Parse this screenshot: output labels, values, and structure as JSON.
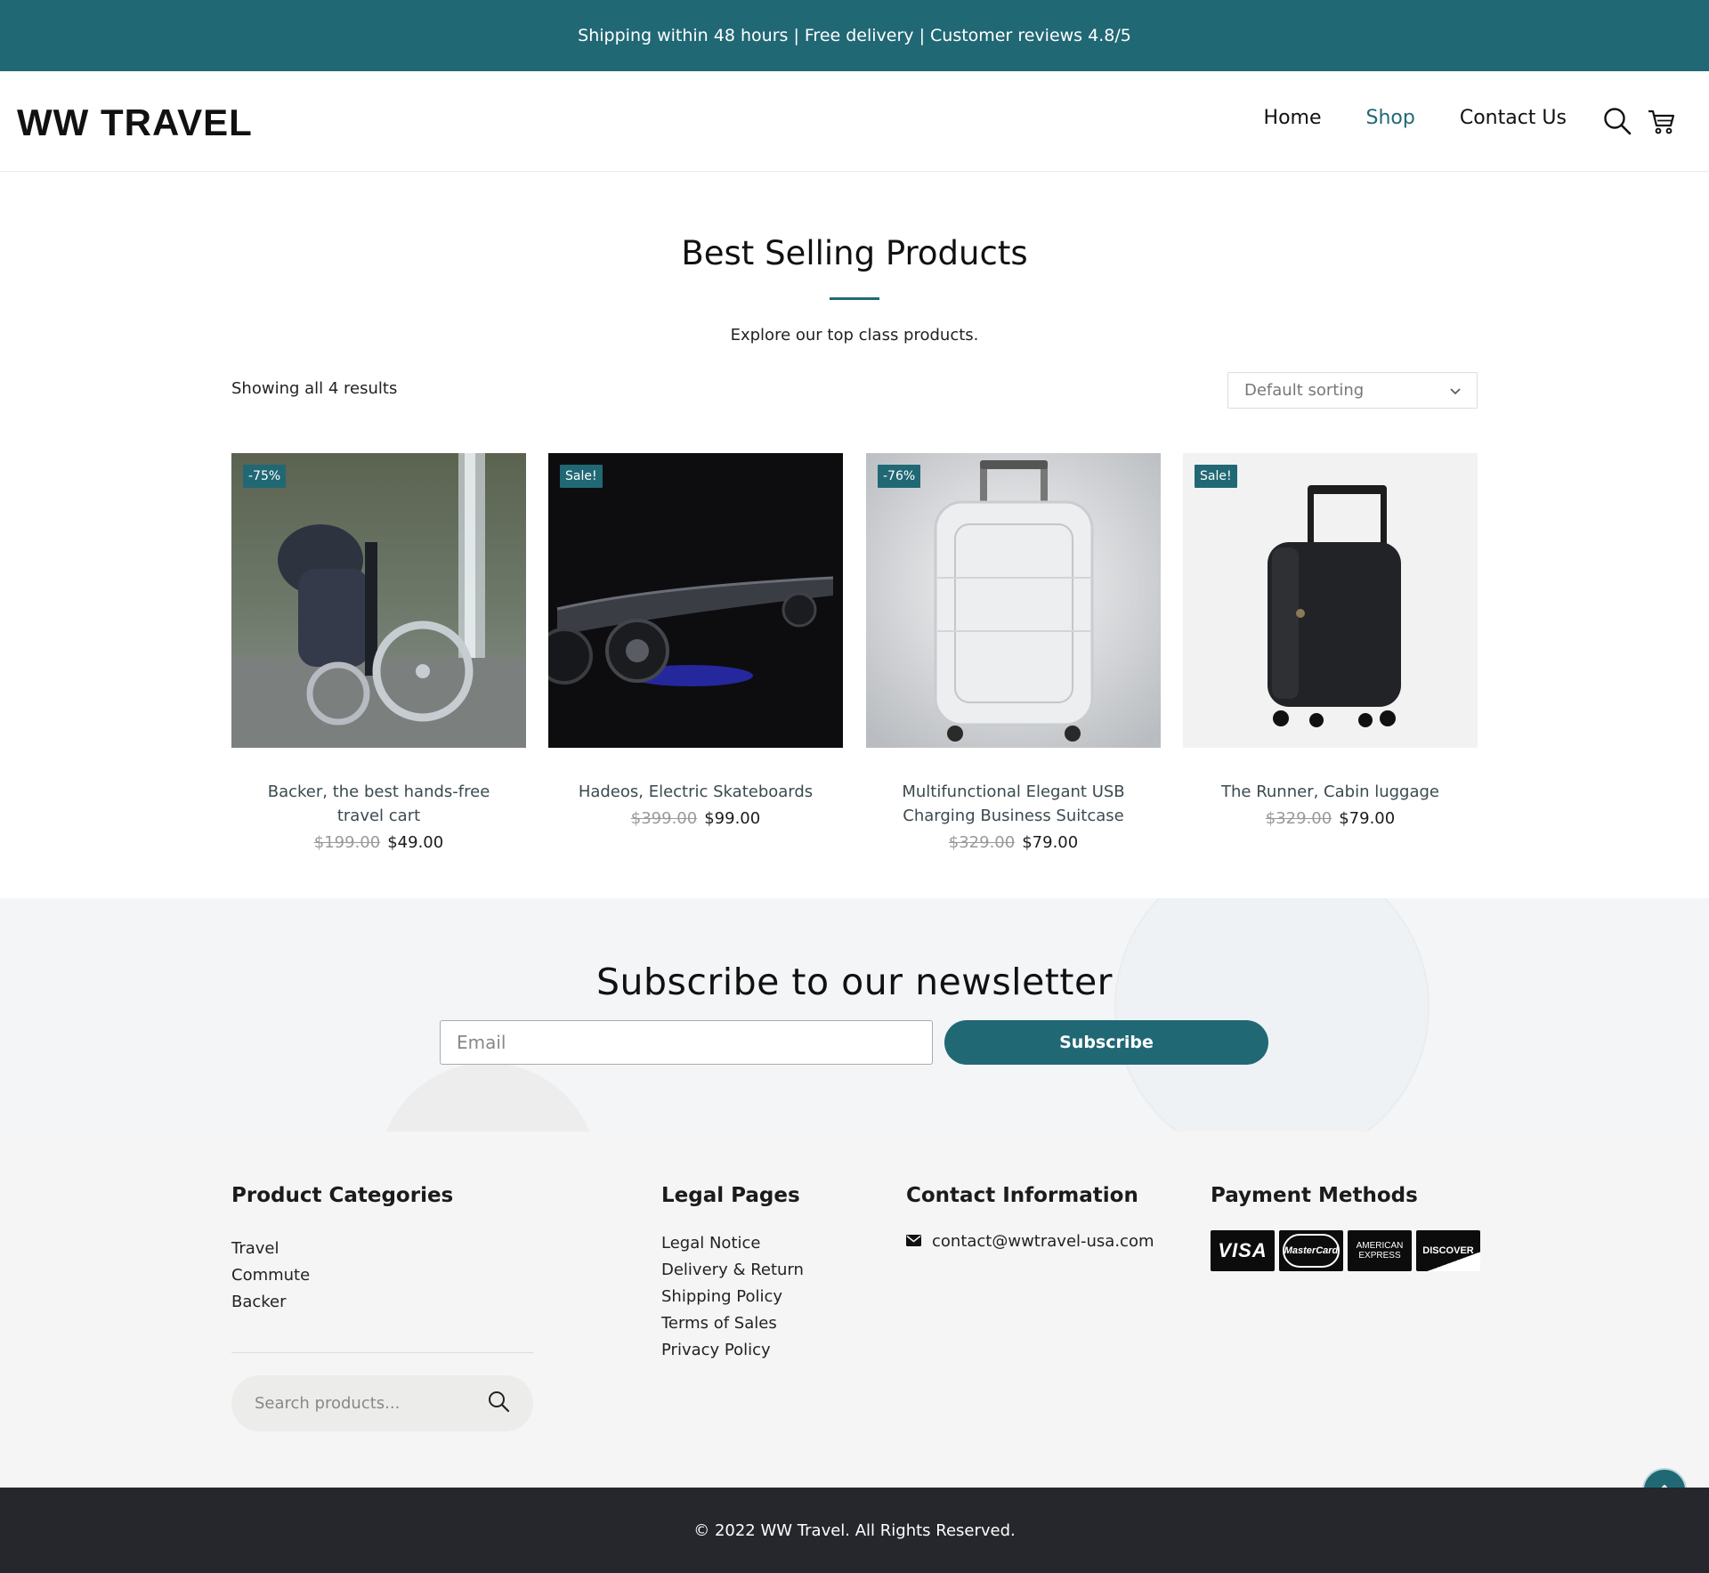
{
  "topbar": {
    "text": "Shipping within 48 hours | Free delivery | Customer reviews 4.8/5",
    "color": "#216875"
  },
  "header": {
    "logo": "WW TRAVEL",
    "nav": [
      "Home",
      "Shop",
      "Contact Us"
    ],
    "active_nav": "Shop",
    "icons": [
      "search-icon",
      "cart-icon"
    ]
  },
  "hero": {
    "title": "Best Selling Products",
    "subtitle": "Explore our top class products."
  },
  "shop": {
    "results_text": "Showing all 4 results",
    "sort_selected": "Default sorting"
  },
  "products": [
    {
      "name": "Backer, the best hands-free travel cart",
      "badge": "-75%",
      "old_price": "$199.00",
      "price": "$49.00"
    },
    {
      "name": "Hadeos, Electric Skateboards",
      "badge": "Sale!",
      "old_price": "$399.00",
      "price": "$99.00"
    },
    {
      "name": "Multifunctional Elegant USB Charging Business Suitcase",
      "badge": "-76%",
      "old_price": "$329.00",
      "price": "$79.00"
    },
    {
      "name": "The Runner, Cabin luggage",
      "badge": "Sale!",
      "old_price": "$329.00",
      "price": "$79.00"
    }
  ],
  "newsletter": {
    "title": "Subscribe to our newsletter",
    "email_placeholder": "Email",
    "button": "Subscribe"
  },
  "footer": {
    "categories": {
      "title": "Product Categories",
      "items": [
        "Travel",
        "Commute",
        "Backer"
      ],
      "search_placeholder": "Search products..."
    },
    "legal": {
      "title": "Legal Pages",
      "items": [
        "Legal Notice",
        "Delivery & Return",
        "Shipping Policy",
        "Terms of Sales",
        "Privacy Policy"
      ]
    },
    "contact": {
      "title": "Contact Information",
      "email": "contact@wwtravel-usa.com"
    },
    "payments": {
      "title": "Payment Methods",
      "cards": [
        "VISA",
        "MasterCard",
        "AMERICAN EXPRESS",
        "DISCOVER"
      ]
    }
  },
  "copyright": "© 2022 WW Travel. All Rights Reserved."
}
